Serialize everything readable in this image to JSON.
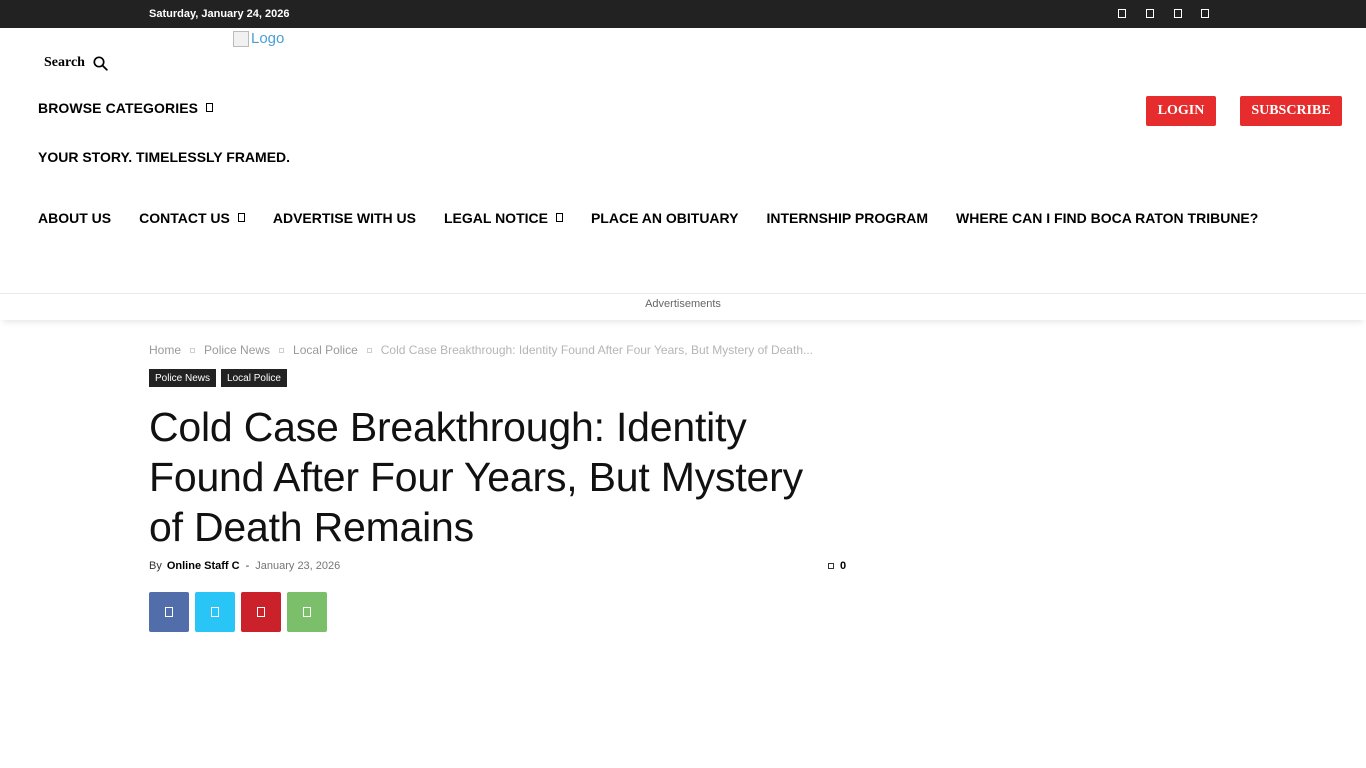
{
  "topbar": {
    "date": "Saturday, January 24, 2026",
    "social_icons": [
      "facebook-icon",
      "instagram-icon",
      "twitter-icon",
      "youtube-icon"
    ]
  },
  "header": {
    "search_label": "Search",
    "logo_alt": "Logo",
    "browse_label": "BROWSE CATEGORIES",
    "login_label": "LOGIN",
    "subscribe_label": "SUBSCRIBE",
    "tagline": "YOUR STORY. TIMELESSLY FRAMED."
  },
  "nav": {
    "items": [
      {
        "label": "ABOUT US",
        "has_dropdown": false
      },
      {
        "label": "CONTACT US",
        "has_dropdown": true
      },
      {
        "label": "ADVERTISE WITH US",
        "has_dropdown": false
      },
      {
        "label": "LEGAL NOTICE",
        "has_dropdown": true
      },
      {
        "label": "PLACE AN OBITUARY",
        "has_dropdown": false
      },
      {
        "label": "INTERNSHIP PROGRAM",
        "has_dropdown": false
      },
      {
        "label": "WHERE CAN I FIND BOCA RATON TRIBUNE?",
        "has_dropdown": false
      }
    ]
  },
  "ad": {
    "label": "Advertisements"
  },
  "breadcrumb": {
    "items": [
      "Home",
      "Police News",
      "Local Police"
    ],
    "current": "Cold Case Breakthrough: Identity Found After Four Years, But Mystery of Death..."
  },
  "article": {
    "tags": [
      "Police News",
      "Local Police"
    ],
    "title": "Cold Case Breakthrough: Identity Found After Four Years, But Mystery of Death Remains",
    "by": "By",
    "author": "Online Staff C",
    "separator": "-",
    "date": "January 23, 2026",
    "comments": "0"
  },
  "share": [
    {
      "icon": "facebook-icon",
      "color": "#516eab"
    },
    {
      "icon": "twitter-icon",
      "color": "#29c5f6"
    },
    {
      "icon": "pinterest-icon",
      "color": "#ca212a"
    },
    {
      "icon": "whatsapp-icon",
      "color": "#7bbf6a"
    }
  ],
  "colors": {
    "accent_red": "#e62c2c",
    "topbar_bg": "#222222"
  }
}
